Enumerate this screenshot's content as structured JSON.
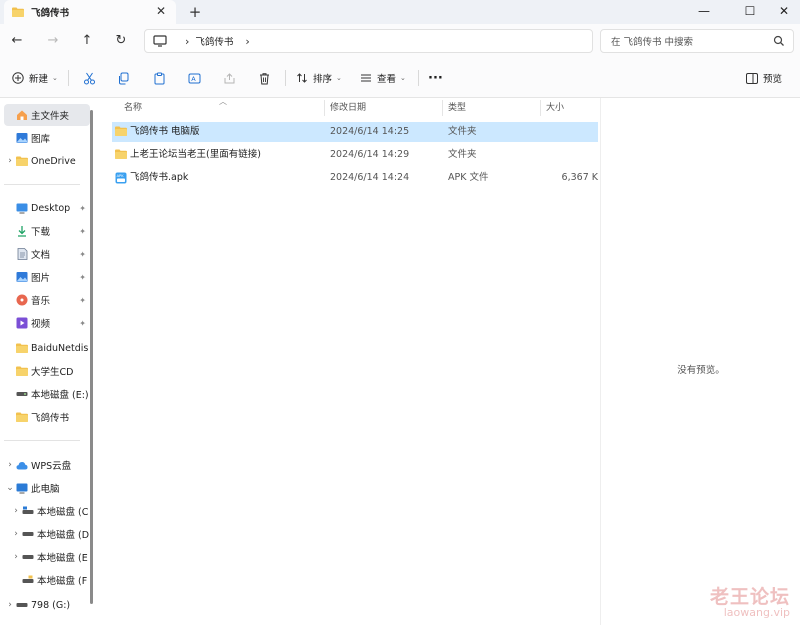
{
  "tab": {
    "title": "飞鸽传书",
    "close_glyph": "✕",
    "new_glyph": "+"
  },
  "window_controls": {
    "minimize": "—",
    "maximize": "☐",
    "close": "✕"
  },
  "nav": {
    "back": "←",
    "forward": "→",
    "up": "↑",
    "refresh": "↻"
  },
  "address": {
    "separator": "›",
    "crumbs": [
      "飞鸽传书"
    ]
  },
  "search": {
    "placeholder": "在 飞鸽传书 中搜索"
  },
  "commandbar": {
    "new_label": "新建",
    "sort_label": "排序",
    "view_label": "查看",
    "more": "···",
    "preview_label": "预览"
  },
  "sidebar": {
    "items": [
      {
        "label": "主文件夹",
        "icon": "home-icon"
      },
      {
        "label": "图库",
        "icon": "gallery-icon"
      },
      {
        "label": "OneDrive",
        "icon": "folder-icon"
      },
      {
        "label": "Desktop",
        "icon": "desktop-icon"
      },
      {
        "label": "下载",
        "icon": "download-icon"
      },
      {
        "label": "文档",
        "icon": "document-icon"
      },
      {
        "label": "图片",
        "icon": "pictures-icon"
      },
      {
        "label": "音乐",
        "icon": "music-icon"
      },
      {
        "label": "视频",
        "icon": "video-icon"
      },
      {
        "label": "BaiduNetdis",
        "icon": "folder-icon"
      },
      {
        "label": "大学生CD",
        "icon": "folder-icon"
      },
      {
        "label": "本地磁盘 (E:)",
        "icon": "drive-icon"
      },
      {
        "label": "飞鸽传书",
        "icon": "folder-icon"
      },
      {
        "label": "WPS云盘",
        "icon": "cloud-icon"
      },
      {
        "label": "此电脑",
        "icon": "pc-icon"
      },
      {
        "label": "本地磁盘 (C",
        "icon": "drive-icon"
      },
      {
        "label": "本地磁盘 (D",
        "icon": "drive-icon"
      },
      {
        "label": "本地磁盘 (E",
        "icon": "drive-icon"
      },
      {
        "label": "本地磁盘 (F",
        "icon": "drive-icon"
      },
      {
        "label": "798 (G:)",
        "icon": "drive-icon"
      }
    ],
    "expander": "›",
    "expander_open": "⌄",
    "pin": "📌"
  },
  "columns": {
    "name": "名称",
    "date": "修改日期",
    "type": "类型",
    "size": "大小"
  },
  "files": [
    {
      "name": "飞鸽传书 电脑版",
      "date": "2024/6/14 14:25",
      "type": "文件夹",
      "size": "",
      "icon": "folder-icon"
    },
    {
      "name": "上老王论坛当老王(里面有链接)",
      "date": "2024/6/14 14:29",
      "type": "文件夹",
      "size": "",
      "icon": "folder-icon"
    },
    {
      "name": "飞鸽传书.apk",
      "date": "2024/6/14 14:24",
      "type": "APK 文件",
      "size": "6,367 K",
      "icon": "apk-icon"
    }
  ],
  "preview": {
    "message": "没有预览。"
  },
  "watermark": {
    "line1": "老王论坛",
    "line2": "laowang.vip"
  },
  "colors": {
    "accent": "#0067c0",
    "folder": "#f2c14e",
    "selected_row": "#cce8ff"
  }
}
